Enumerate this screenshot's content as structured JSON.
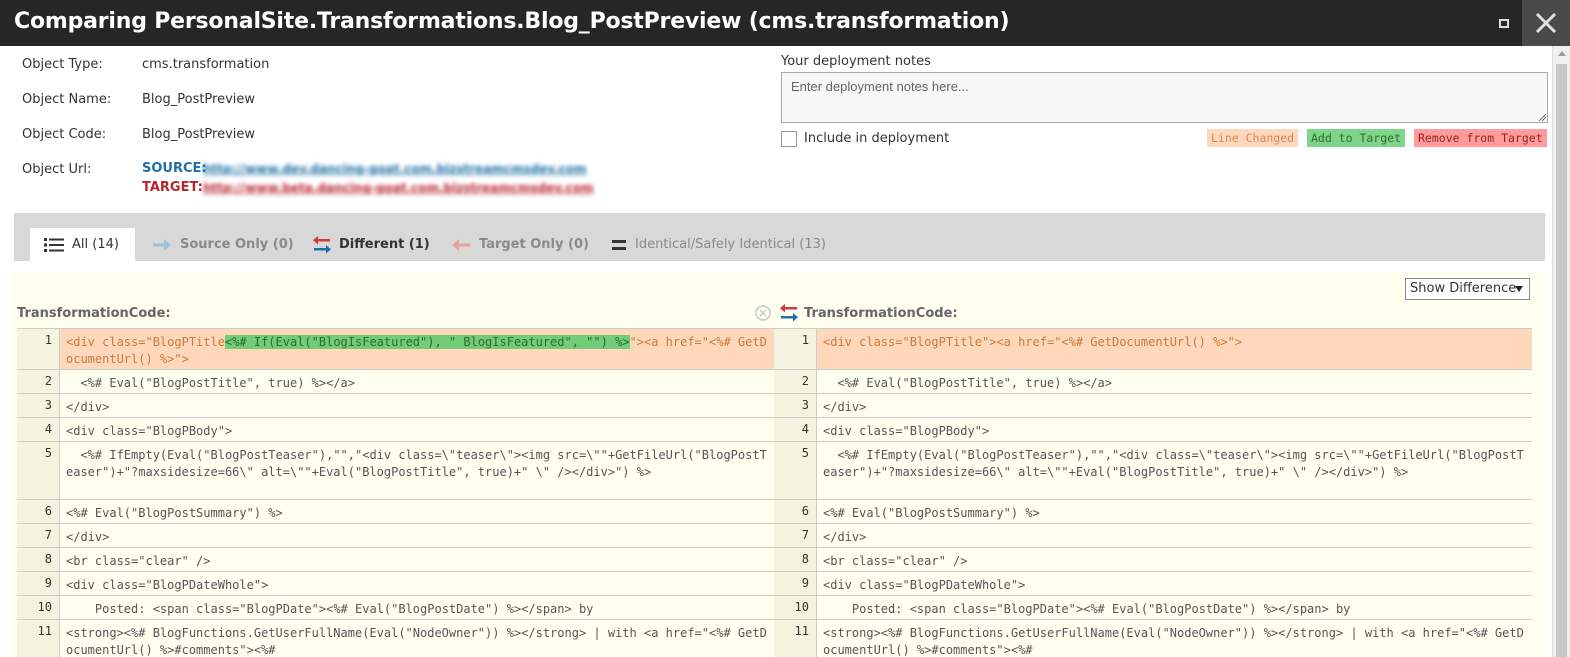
{
  "window": {
    "title": "Comparing PersonalSite.Transformations.Blog_PostPreview (cms.transformation)"
  },
  "info": {
    "object_type_label": "Object Type:",
    "object_type": "cms.transformation",
    "object_name_label": "Object Name:",
    "object_name": "Blog_PostPreview",
    "object_code_label": "Object Code:",
    "object_code": "Blog_PostPreview",
    "object_url_label": "Object Url:",
    "source_label": "SOURCE:",
    "source_url": "http://www.dev.dancing-goat.com.bizstreamcmsdev.com",
    "target_label": "TARGET:",
    "target_url": "http://www.beta.dancing-goat.com.bizstreamcmsdev.com"
  },
  "deployment": {
    "label": "Your deployment notes",
    "placeholder": "Enter deployment notes here...",
    "include_label": "Include in deployment"
  },
  "legend": {
    "line_changed": "Line Changed",
    "add_to_target": "Add to Target",
    "remove_from_target": "Remove from Target"
  },
  "tabs": {
    "all": "All (14)",
    "source_only": "Source Only (0)",
    "different": "Different (1)",
    "target_only": "Target Only (0)",
    "identical": "Identical/Safely Identical (13)"
  },
  "diff": {
    "show_difference": "Show Difference",
    "left_header": "TransformationCode:",
    "right_header": "TransformationCode:",
    "left_lines": [
      {
        "n": "1",
        "pre": "<div class=\"BlogPTitle",
        "hl": "<%# If(Eval(\"BlogIsFeatured\"), \" BlogIsFeatured\", \"\") %>",
        "post": "\"><a href=\"<%# GetDocumentUrl() %>\">"
      },
      {
        "n": "2",
        "text": "  <%# Eval(\"BlogPostTitle\", true) %></a>"
      },
      {
        "n": "3",
        "text": "</div>"
      },
      {
        "n": "4",
        "text": "<div class=\"BlogPBody\">"
      },
      {
        "n": "5",
        "text": "  <%# IfEmpty(Eval(\"BlogPostTeaser\"),\"\",\"<div class=\\\"teaser\\\"><img src=\\\"\"+GetFileUrl(\"BlogPostTeaser\")+\"?maxsidesize=66\\\" alt=\\\"\"+Eval(\"BlogPostTitle\", true)+\" \\\" /></div>\") %>"
      },
      {
        "n": "6",
        "text": "<%# Eval(\"BlogPostSummary\") %>"
      },
      {
        "n": "7",
        "text": "</div>"
      },
      {
        "n": "8",
        "text": "<br class=\"clear\" />"
      },
      {
        "n": "9",
        "text": "<div class=\"BlogPDateWhole\">"
      },
      {
        "n": "10",
        "text": "    Posted: <span class=\"BlogPDate\"><%# Eval(\"BlogPostDate\") %></span> by"
      },
      {
        "n": "11",
        "text": "<strong><%# BlogFunctions.GetUserFullName(Eval(\"NodeOwner\")) %></strong> | with <a href=\"<%# GetDocumentUrl() %>#comments\"><%#"
      }
    ],
    "right_lines": [
      {
        "n": "1",
        "text": "<div class=\"BlogPTitle\"><a href=\"<%# GetDocumentUrl() %>\">"
      },
      {
        "n": "2",
        "text": "  <%# Eval(\"BlogPostTitle\", true) %></a>"
      },
      {
        "n": "3",
        "text": "</div>"
      },
      {
        "n": "4",
        "text": "<div class=\"BlogPBody\">"
      },
      {
        "n": "5",
        "text": "  <%# IfEmpty(Eval(\"BlogPostTeaser\"),\"\",\"<div class=\\\"teaser\\\"><img src=\\\"\"+GetFileUrl(\"BlogPostTeaser\")+\"?maxsidesize=66\\\" alt=\\\"\"+Eval(\"BlogPostTitle\", true)+\" \\\" /></div>\") %>"
      },
      {
        "n": "6",
        "text": "<%# Eval(\"BlogPostSummary\") %>"
      },
      {
        "n": "7",
        "text": "</div>"
      },
      {
        "n": "8",
        "text": "<br class=\"clear\" />"
      },
      {
        "n": "9",
        "text": "<div class=\"BlogPDateWhole\">"
      },
      {
        "n": "10",
        "text": "    Posted: <span class=\"BlogPDate\"><%# Eval(\"BlogPostDate\") %></span> by"
      },
      {
        "n": "11",
        "text": "<strong><%# BlogFunctions.GetUserFullName(Eval(\"NodeOwner\")) %></strong> | with <a href=\"<%# GetDocumentUrl() %>#comments\"><%#"
      }
    ]
  },
  "colors": {
    "titlebar": "#262626",
    "source": "#1d6fa5",
    "target": "#b8252e",
    "changed_line": "#ffd8bb",
    "added": "#72cc7a"
  }
}
